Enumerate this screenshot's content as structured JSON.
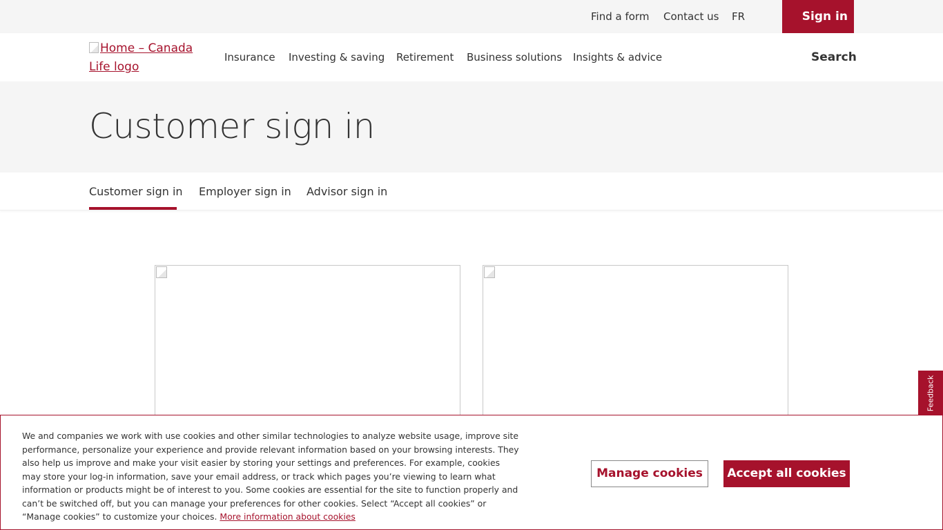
{
  "utility": {
    "find_form": "Find a form",
    "contact_us": "Contact us",
    "language": "FR",
    "sign_in": "Sign in"
  },
  "nav": {
    "logo_alt": "Home – Canada Life logo",
    "items": [
      "Insurance",
      "Investing & saving",
      "Retirement",
      "Business solutions",
      "Insights & advice"
    ],
    "search": "Search"
  },
  "hero": {
    "title": "Customer sign in"
  },
  "tabs": [
    "Customer sign in",
    "Employer sign in",
    "Advisor sign in"
  ],
  "feedback": "Feedback",
  "cookie": {
    "text": "We and companies we work with use cookies and other similar technologies to analyze website usage, improve site performance, personalize your experience and provide relevant information based on your browsing interests. They also help us improve and make your visit easier by storing your settings and preferences. For example, cookies may store your log-in information, save your email address, or track which pages you’re viewing to learn what information or products might be of interest to you. Some cookies are essential for the site to function properly and can’t be switched off, but you can manage your preferences for other cookies. Select “Accept all cookies” or “Manage cookies” to customize your choices.",
    "more_link": "More information about cookies",
    "manage": "Manage cookies",
    "accept": "Accept all cookies"
  },
  "colors": {
    "brand": "#a6122c",
    "bar_bg": "#f5f5f5"
  }
}
